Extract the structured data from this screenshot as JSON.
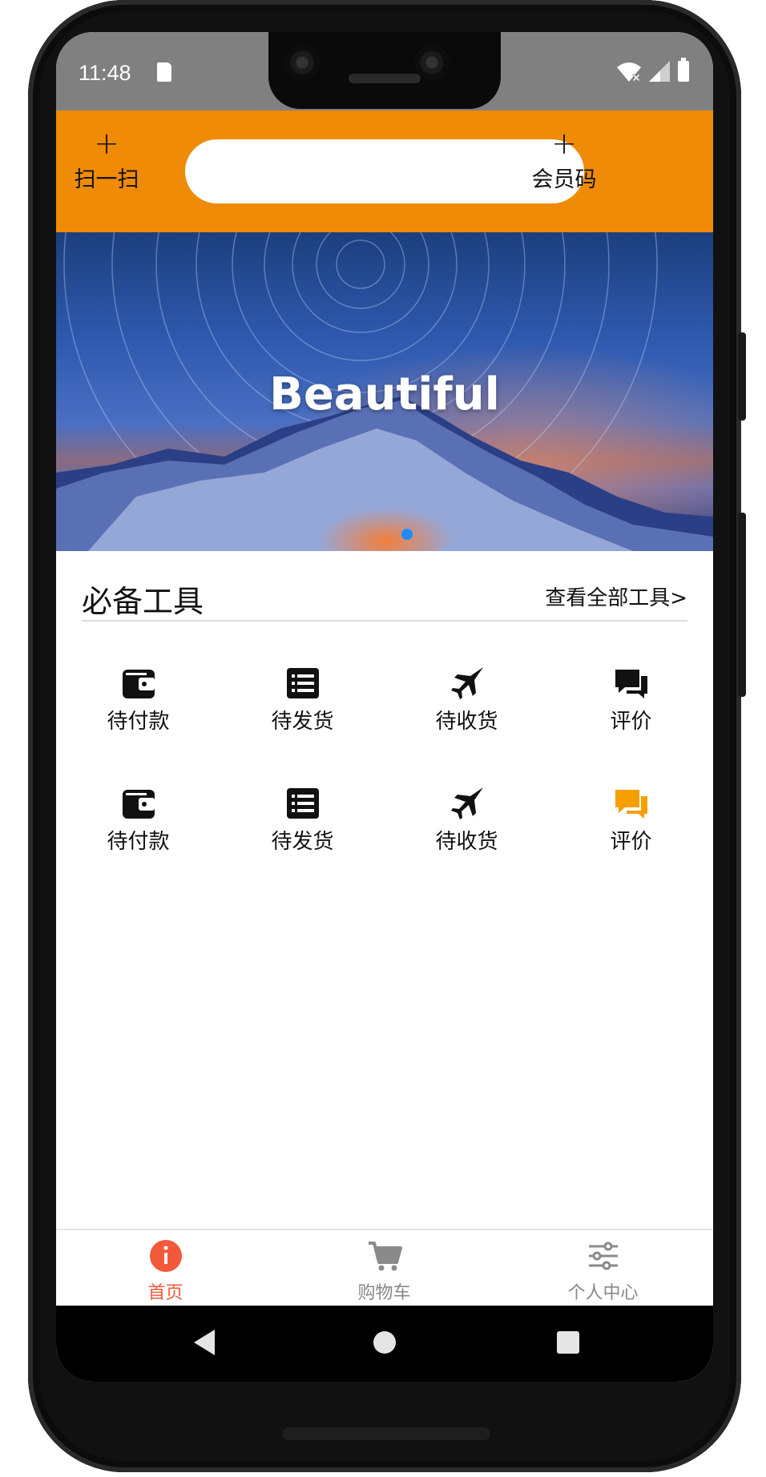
{
  "status_bar": {
    "time": "11:48"
  },
  "header": {
    "left_button": {
      "icon": "plus-icon",
      "label": "扫一扫"
    },
    "search": {
      "value": "",
      "placeholder": ""
    },
    "right_button": {
      "icon": "plus-icon",
      "label": "会员码"
    },
    "background_color": "#ef8b06"
  },
  "banner": {
    "title": "Beautiful",
    "indicator_color": "#1a8cff"
  },
  "tools": {
    "title": "必备工具",
    "view_all": "查看全部工具>",
    "items": [
      {
        "icon": "wallet-icon",
        "label": "待付款"
      },
      {
        "icon": "list-icon",
        "label": "待发货"
      },
      {
        "icon": "jet-icon",
        "label": "待收货"
      },
      {
        "icon": "comments-icon",
        "label": "评价"
      },
      {
        "icon": "wallet-icon",
        "label": "待付款"
      },
      {
        "icon": "list-icon",
        "label": "待发货"
      },
      {
        "icon": "jet-icon",
        "label": "待收货"
      },
      {
        "icon": "comments-icon",
        "label": "评价",
        "color": "#f5a000"
      }
    ]
  },
  "bottom_nav": {
    "items": [
      {
        "icon": "info-icon",
        "label": "首页",
        "active": true,
        "color": "#f2593a"
      },
      {
        "icon": "cart-icon",
        "label": "购物车",
        "active": false
      },
      {
        "icon": "sliders-icon",
        "label": "个人中心",
        "active": false
      }
    ]
  }
}
